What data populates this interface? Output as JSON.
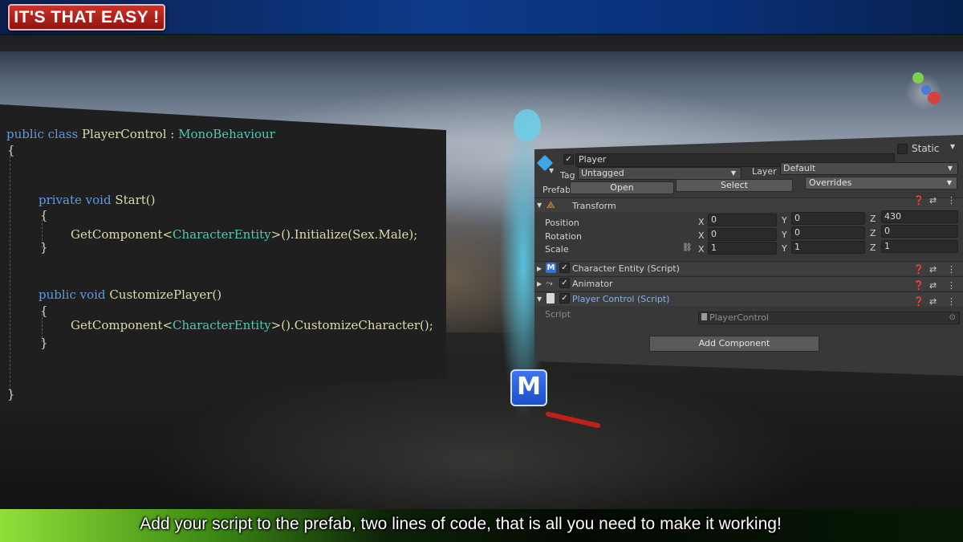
{
  "banner": {
    "title": "IT'S THAT EASY !"
  },
  "code": {
    "line1_kw": "public class",
    "line1_name": "PlayerControl",
    "line1_colon": ":",
    "line1_base": "MonoBehaviour",
    "brace_open": "{",
    "brace_close": "}",
    "method1_kw": "private void",
    "method1_name": "Start()",
    "method1_call_a": "GetComponent<",
    "method1_call_type": "CharacterEntity",
    "method1_call_b": ">().Initialize(Sex.Male);",
    "method2_kw": "public void",
    "method2_name": "CustomizePlayer()",
    "method2_call_a": "GetComponent<",
    "method2_call_type": "CharacterEntity",
    "method2_call_b": ">().CustomizeCharacter();"
  },
  "inspector": {
    "object_name": "Player",
    "static_label": "Static",
    "tag_label": "Tag",
    "tag_value": "Untagged",
    "layer_label": "Layer",
    "layer_value": "Default",
    "prefab_label": "Prefab",
    "open_button": "Open",
    "select_button": "Select",
    "overrides_button": "Overrides",
    "transform_title": "Transform",
    "position_label": "Position",
    "rotation_label": "Rotation",
    "scale_label": "Scale",
    "axis_x": "X",
    "axis_y": "Y",
    "axis_z": "Z",
    "position": {
      "x": "0",
      "y": "0",
      "z": "430"
    },
    "rotation": {
      "x": "0",
      "y": "0",
      "z": "0"
    },
    "scale": {
      "x": "1",
      "y": "1",
      "z": "1"
    },
    "components": [
      {
        "label": "Character Entity (Script)",
        "icon": "M"
      },
      {
        "label": "Animator"
      },
      {
        "label": "Player Control (Script)"
      }
    ],
    "script_label": "Script",
    "script_value": "PlayerControl",
    "add_component_button": "Add Component"
  },
  "scene": {
    "marker_letter": "M"
  },
  "caption": "Add your script to the prefab, two lines of code, that is all you need to make it working!"
}
